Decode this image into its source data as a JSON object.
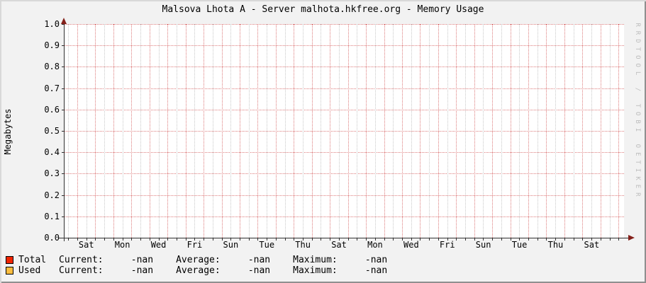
{
  "title": "Malsova Lhota A - Server malhota.hkfree.org - Memory Usage",
  "watermark": "RRDTOOL / TOBI OETIKER",
  "y_axis": {
    "label": "Megabytes",
    "ticks": [
      "1.0",
      "0.9",
      "0.8",
      "0.7",
      "0.6",
      "0.5",
      "0.4",
      "0.3",
      "0.2",
      "0.1",
      "0.0"
    ]
  },
  "x_axis": {
    "ticks": [
      "Sat",
      "Mon",
      "Wed",
      "Fri",
      "Sun",
      "Tue",
      "Thu",
      "Sat",
      "Mon",
      "Wed",
      "Fri",
      "Sun",
      "Tue",
      "Thu",
      "Sat"
    ]
  },
  "legend": {
    "rows": [
      {
        "swatch_color": "#f12500",
        "name": "Total",
        "current_label": "Current:",
        "current_value": "-nan",
        "average_label": "Average:",
        "average_value": "-nan",
        "maximum_label": "Maximum:",
        "maximum_value": "-nan"
      },
      {
        "swatch_color": "#fcbd3f",
        "name": "Used",
        "current_label": "Current:",
        "current_value": "-nan",
        "average_label": "Average:",
        "average_value": "-nan",
        "maximum_label": "Maximum:",
        "maximum_value": "-nan"
      }
    ]
  },
  "colors": {
    "background": "#f2f2f2",
    "canvas": "#ffffff",
    "major_grid": "#dd7b7b",
    "minor_grid": "#c8c8c8",
    "axis": "#313131",
    "arrow": "#84201a",
    "watermark": "#bdbdbd",
    "bevel_light": "#d8d8d8",
    "bevel_dark": "#8f8f8f",
    "total_series": "#f12500",
    "used_series": "#fcbd3f"
  },
  "chart_data": {
    "type": "area",
    "title": "Malsova Lhota A - Server malhota.hkfree.org - Memory Usage",
    "xlabel": "",
    "ylabel": "Megabytes",
    "ylim": [
      0.0,
      1.0
    ],
    "y_ticks": [
      0.0,
      0.1,
      0.2,
      0.3,
      0.4,
      0.5,
      0.6,
      0.7,
      0.8,
      0.9,
      1.0
    ],
    "x_tick_labels": [
      "Sat",
      "Mon",
      "Wed",
      "Fri",
      "Sun",
      "Tue",
      "Thu",
      "Sat",
      "Mon",
      "Wed",
      "Fri",
      "Sun",
      "Tue",
      "Thu",
      "Sat"
    ],
    "grid": true,
    "legend_position": "bottom",
    "series": [
      {
        "name": "Total",
        "color": "#f12500",
        "values": [],
        "stats": {
          "current": "-nan",
          "average": "-nan",
          "maximum": "-nan"
        }
      },
      {
        "name": "Used",
        "color": "#fcbd3f",
        "values": [],
        "stats": {
          "current": "-nan",
          "average": "-nan",
          "maximum": "-nan"
        }
      }
    ],
    "note_visible_on_screen": "no plotted data; all statistics shown as -nan"
  }
}
